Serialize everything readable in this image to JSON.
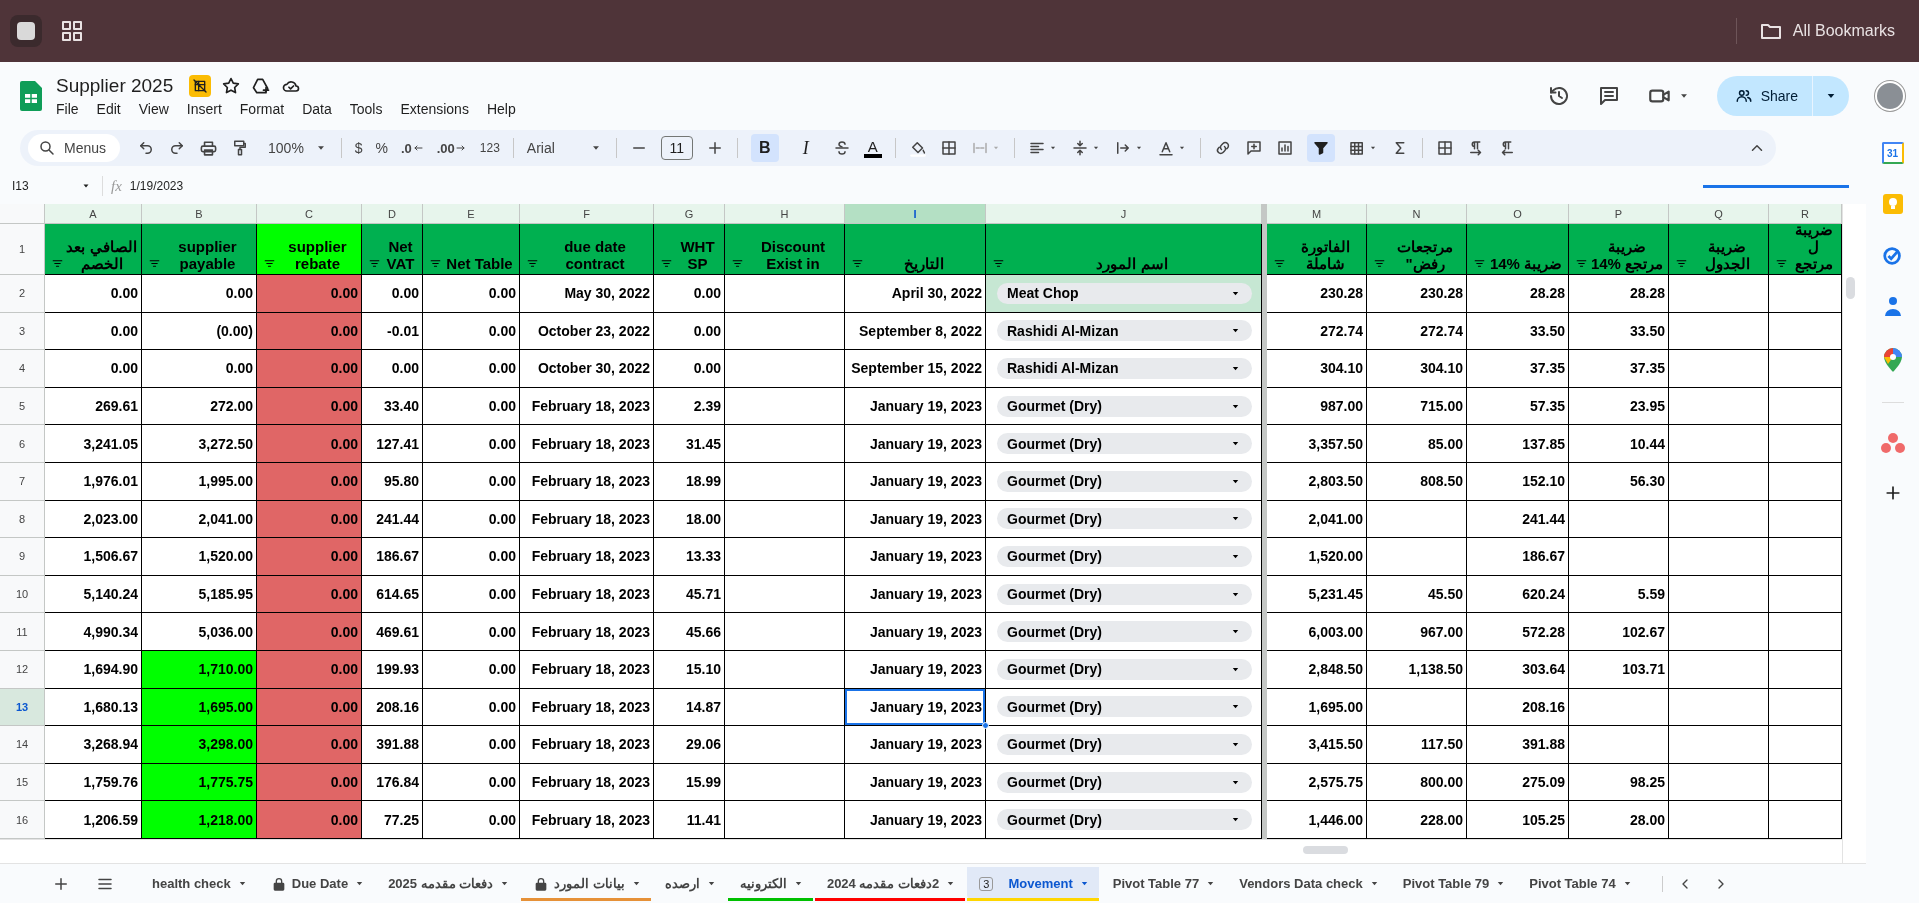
{
  "browser": {
    "bookmarks": "All Bookmarks"
  },
  "document": {
    "title": "Supplier 2025",
    "starred": false,
    "menus": [
      "File",
      "Edit",
      "View",
      "Insert",
      "Format",
      "Data",
      "Tools",
      "Extensions",
      "Help"
    ],
    "share": "Share"
  },
  "toolbar": {
    "search": "Menus",
    "zoom": "100%",
    "currency": "$",
    "percent": "%",
    "decrease_decimals": ".0",
    "increase_decimals": ".00",
    "number_format": "123",
    "font": "Arial",
    "font_size": "11",
    "bold": "B",
    "bold_on": true,
    "italic": "I",
    "text_color": "A",
    "filter_on": true
  },
  "formula_bar": {
    "cell": "I13",
    "function_label": "fx",
    "formula": "1/19/2023"
  },
  "sheet": {
    "header_row": "1",
    "columns": [
      {
        "letter": "A",
        "title": "الصافي بعد الخصم",
        "color": "#00b050",
        "kind": "text",
        "selected": false,
        "frozen_edge": false
      },
      {
        "letter": "B",
        "title": "supplier payable",
        "color": "#00b050",
        "kind": "text",
        "selected": false,
        "frozen_edge": false
      },
      {
        "letter": "C",
        "title": "supplier rebate",
        "color": "#00ff00",
        "kind": "text",
        "selected": false,
        "frozen_edge": false
      },
      {
        "letter": "D",
        "title": "Net VAT",
        "color": "#00b050",
        "kind": "text",
        "selected": false,
        "frozen_edge": false
      },
      {
        "letter": "E",
        "title": "Net Table",
        "color": "#00b050",
        "kind": "text",
        "selected": false,
        "frozen_edge": false
      },
      {
        "letter": "F",
        "title": "due date contract",
        "color": "#00b050",
        "kind": "text",
        "selected": false,
        "frozen_edge": false
      },
      {
        "letter": "G",
        "title": "WHT SP",
        "color": "#00b050",
        "kind": "text",
        "selected": false,
        "frozen_edge": false
      },
      {
        "letter": "H",
        "title": "Discount Exist in",
        "color": "#00b050",
        "kind": "text",
        "selected": false,
        "frozen_edge": false
      },
      {
        "letter": "I",
        "title": "التاريخ",
        "color": "#00b050",
        "kind": "text",
        "selected": true,
        "frozen_edge": false
      },
      {
        "letter": "J",
        "title": "اسم المورد",
        "color": "#00b050",
        "kind": "dropdown",
        "selected": false,
        "frozen_edge": true
      },
      {
        "letter": "M",
        "title": "الفاتورة شاملة",
        "color": "#00b050",
        "kind": "text",
        "selected": false,
        "frozen_edge": false
      },
      {
        "letter": "N",
        "title": "مرتجعات رفض\"",
        "color": "#00b050",
        "kind": "text",
        "selected": false,
        "frozen_edge": false
      },
      {
        "letter": "O",
        "title": "ضريبة %14",
        "color": "#00b050",
        "kind": "text",
        "selected": false,
        "frozen_edge": false
      },
      {
        "letter": "P",
        "title": "ضريبة مرتجع %14",
        "color": "#00b050",
        "kind": "text",
        "selected": false,
        "frozen_edge": false
      },
      {
        "letter": "Q",
        "title": "ضريبة الجدول",
        "color": "#00b050",
        "kind": "text",
        "selected": false,
        "frozen_edge": false
      },
      {
        "letter": "R",
        "title": "ضريبة ل مرتجع",
        "color": "#00b050",
        "kind": "text",
        "selected": false,
        "frozen_edge": false
      }
    ],
    "rows": [
      {
        "number": "2",
        "selected": false,
        "cells": [
          "0.00",
          "0.00",
          {
            "text": "0.00",
            "color": "#e06666"
          },
          "0.00",
          "0.00",
          "May 30, 2022",
          "0.00",
          null,
          "April 30, 2022",
          {
            "text": "Meat Chop",
            "color": "#c6e7d3"
          },
          "230.28",
          "230.28",
          "28.28",
          "28.28",
          null,
          null
        ]
      },
      {
        "number": "3",
        "selected": false,
        "cells": [
          "0.00",
          "(0.00)",
          {
            "text": "0.00",
            "color": "#e06666"
          },
          "-0.01",
          "0.00",
          "October 23, 2022",
          "0.00",
          null,
          "September 8, 2022",
          "Rashidi Al-Mizan",
          "272.74",
          "272.74",
          "33.50",
          "33.50",
          null,
          null
        ]
      },
      {
        "number": "4",
        "selected": false,
        "cells": [
          "0.00",
          "0.00",
          {
            "text": "0.00",
            "color": "#e06666"
          },
          "0.00",
          "0.00",
          "October 30, 2022",
          "0.00",
          null,
          "September 15, 2022",
          "Rashidi Al-Mizan",
          "304.10",
          "304.10",
          "37.35",
          "37.35",
          null,
          null
        ]
      },
      {
        "number": "5",
        "selected": false,
        "cells": [
          "269.61",
          "272.00",
          {
            "text": "0.00",
            "color": "#e06666"
          },
          "33.40",
          "0.00",
          "February 18, 2023",
          "2.39",
          null,
          "January 19, 2023",
          "Gourmet (Dry)",
          "987.00",
          "715.00",
          "57.35",
          "23.95",
          null,
          null
        ]
      },
      {
        "number": "6",
        "selected": false,
        "cells": [
          "3,241.05",
          "3,272.50",
          {
            "text": "0.00",
            "color": "#e06666"
          },
          "127.41",
          "0.00",
          "February 18, 2023",
          "31.45",
          null,
          "January 19, 2023",
          "Gourmet (Dry)",
          "3,357.50",
          "85.00",
          "137.85",
          "10.44",
          null,
          null
        ]
      },
      {
        "number": "7",
        "selected": false,
        "cells": [
          "1,976.01",
          "1,995.00",
          {
            "text": "0.00",
            "color": "#e06666"
          },
          "95.80",
          "0.00",
          "February 18, 2023",
          "18.99",
          null,
          "January 19, 2023",
          "Gourmet (Dry)",
          "2,803.50",
          "808.50",
          "152.10",
          "56.30",
          null,
          null
        ]
      },
      {
        "number": "8",
        "selected": false,
        "cells": [
          "2,023.00",
          "2,041.00",
          {
            "text": "0.00",
            "color": "#e06666"
          },
          "241.44",
          "0.00",
          "February 18, 2023",
          "18.00",
          null,
          "January 19, 2023",
          "Gourmet (Dry)",
          "2,041.00",
          null,
          "241.44",
          null,
          null,
          null
        ]
      },
      {
        "number": "9",
        "selected": false,
        "cells": [
          "1,506.67",
          "1,520.00",
          {
            "text": "0.00",
            "color": "#e06666"
          },
          "186.67",
          "0.00",
          "February 18, 2023",
          "13.33",
          null,
          "January 19, 2023",
          "Gourmet (Dry)",
          "1,520.00",
          null,
          "186.67",
          null,
          null,
          null
        ]
      },
      {
        "number": "10",
        "selected": false,
        "cells": [
          "5,140.24",
          "5,185.95",
          {
            "text": "0.00",
            "color": "#e06666"
          },
          "614.65",
          "0.00",
          "February 18, 2023",
          "45.71",
          null,
          "January 19, 2023",
          "Gourmet (Dry)",
          "5,231.45",
          "45.50",
          "620.24",
          "5.59",
          null,
          null
        ]
      },
      {
        "number": "11",
        "selected": false,
        "cells": [
          "4,990.34",
          "5,036.00",
          {
            "text": "0.00",
            "color": "#e06666"
          },
          "469.61",
          "0.00",
          "February 18, 2023",
          "45.66",
          null,
          "January 19, 2023",
          "Gourmet (Dry)",
          "6,003.00",
          "967.00",
          "572.28",
          "102.67",
          null,
          null
        ]
      },
      {
        "number": "12",
        "selected": false,
        "cells": [
          "1,694.90",
          {
            "text": "1,710.00",
            "color": "#00ff00"
          },
          {
            "text": "0.00",
            "color": "#e06666"
          },
          "199.93",
          "0.00",
          "February 18, 2023",
          "15.10",
          null,
          "January 19, 2023",
          "Gourmet (Dry)",
          "2,848.50",
          "1,138.50",
          "303.64",
          "103.71",
          null,
          null
        ]
      },
      {
        "number": "13",
        "selected": true,
        "cells": [
          "1,680.13",
          {
            "text": "1,695.00",
            "color": "#00ff00"
          },
          {
            "text": "0.00",
            "color": "#e06666"
          },
          "208.16",
          "0.00",
          "February 18, 2023",
          "14.87",
          null,
          "January 19, 2023",
          "Gourmet (Dry)",
          "1,695.00",
          null,
          "208.16",
          null,
          null,
          null
        ]
      },
      {
        "number": "14",
        "selected": false,
        "cells": [
          "3,268.94",
          {
            "text": "3,298.00",
            "color": "#00ff00"
          },
          {
            "text": "0.00",
            "color": "#e06666"
          },
          "391.88",
          "0.00",
          "February 18, 2023",
          "29.06",
          null,
          "January 19, 2023",
          "Gourmet (Dry)",
          "3,415.50",
          "117.50",
          "391.88",
          null,
          null,
          null
        ]
      },
      {
        "number": "15",
        "selected": false,
        "cells": [
          "1,759.76",
          {
            "text": "1,775.75",
            "color": "#00ff00"
          },
          {
            "text": "0.00",
            "color": "#e06666"
          },
          "176.84",
          "0.00",
          "February 18, 2023",
          "15.99",
          null,
          "January 19, 2023",
          "Gourmet (Dry)",
          "2,575.75",
          "800.00",
          "275.09",
          "98.25",
          null,
          null
        ]
      },
      {
        "number": "16",
        "selected": false,
        "cells": [
          "1,206.59",
          {
            "text": "1,218.00",
            "color": "#00ff00"
          },
          {
            "text": "0.00",
            "color": "#e06666"
          },
          "77.25",
          "0.00",
          "February 18, 2023",
          "11.41",
          null,
          "January 19, 2023",
          "Gourmet (Dry)",
          "1,446.00",
          "228.00",
          "105.25",
          "28.00",
          null,
          null
        ]
      }
    ]
  },
  "side_panel": {
    "calendar_day": "31"
  },
  "sheet_tabs": [
    {
      "label": "health check",
      "locked": false,
      "selected": false
    },
    {
      "label": "Due Date",
      "locked": true,
      "selected": false
    },
    {
      "label": "دفعات مقدمه 2025",
      "locked": false,
      "selected": false
    },
    {
      "label": "بيانات المورد",
      "locked": true,
      "selected": false,
      "color": "#e69138"
    },
    {
      "label": "ارصده",
      "locked": false,
      "selected": false
    },
    {
      "label": "الكترونيه",
      "locked": false,
      "selected": false,
      "color": "#00c000"
    },
    {
      "label": "2دفعات مقدمه 2024",
      "locked": false,
      "selected": false,
      "color": "#ff0000"
    },
    {
      "label": "Movement",
      "badge": "3",
      "locked": false,
      "selected": true,
      "color": "#ffd600"
    },
    {
      "label": "Pivot Table 77",
      "locked": false,
      "selected": false
    },
    {
      "label": "Vendors Data check",
      "locked": false,
      "selected": false
    },
    {
      "label": "Pivot Table 79",
      "locked": false,
      "selected": false
    },
    {
      "label": "Pivot Table 74",
      "locked": false,
      "selected": false
    }
  ]
}
